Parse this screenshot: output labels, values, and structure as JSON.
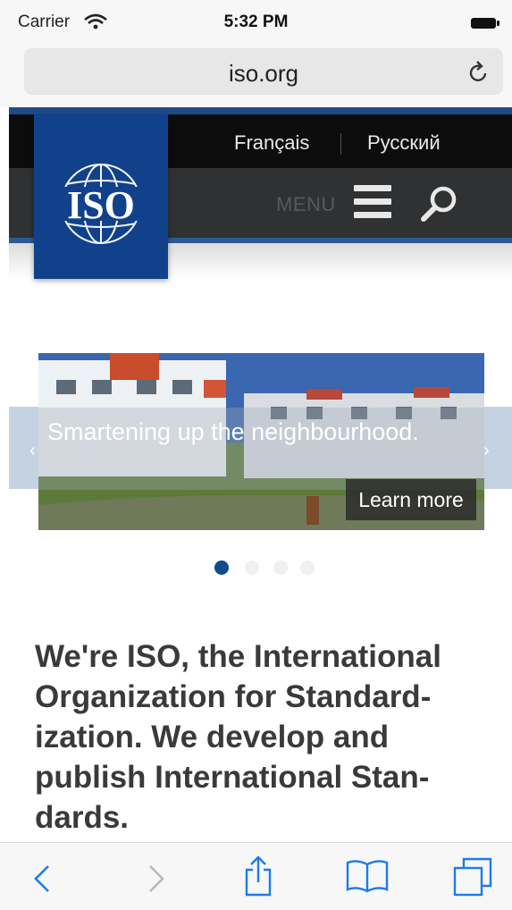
{
  "status_bar": {
    "carrier": "Carrier",
    "time": "5:32 PM"
  },
  "browser": {
    "url": "iso.org"
  },
  "header": {
    "languages": [
      "Français",
      "Русский"
    ],
    "menu_label": "MENU",
    "logo_text": "ISO"
  },
  "carousel": {
    "caption": "Smartening up the neighbourhood.",
    "button": "Learn more",
    "slide_count": 4,
    "active_slide": 1
  },
  "headline": "We're ISO, the International Organization for Standard-ization. We develop and publish International Stan-dards.",
  "colors": {
    "iso_blue": "#11418a",
    "active_dot": "#124b8e",
    "ios_tint": "#1a7bf0"
  },
  "toolbar_icons": [
    "back-icon",
    "forward-icon",
    "share-icon",
    "bookmarks-icon",
    "tabs-icon"
  ]
}
